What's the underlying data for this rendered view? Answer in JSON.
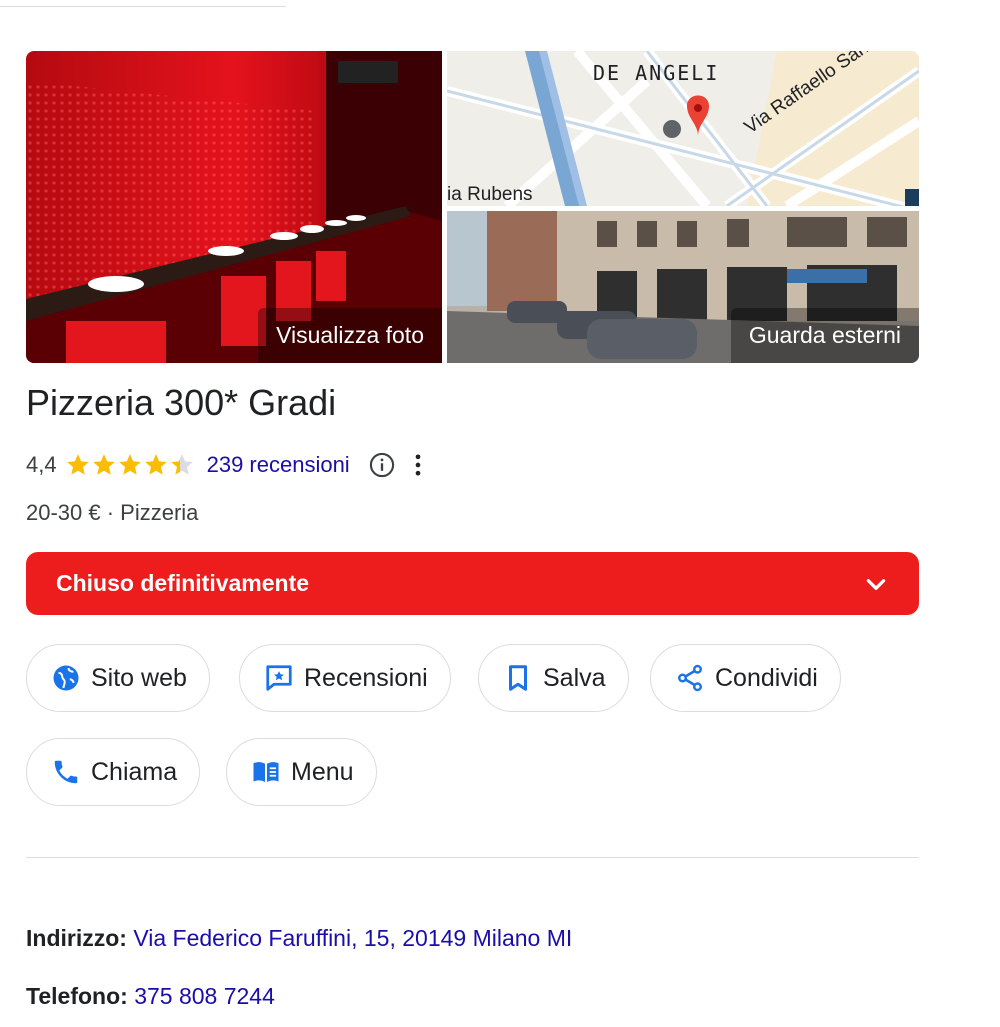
{
  "photos": {
    "main_label": "Visualizza foto",
    "street_label": "Guarda esterni",
    "map_labels": {
      "district": "DE ANGELI",
      "street_left": "ia Rubens",
      "street_right": "Via Raffaello Sanzio"
    }
  },
  "place": {
    "name": "Pizzeria 300* Gradi",
    "rating": "4,4",
    "stars": 4.4,
    "reviews": "239 recensioni",
    "subline": "20-30 € · Pizzeria"
  },
  "status": {
    "label": "Chiuso definitivamente",
    "color": "#ee1d1d"
  },
  "actions": [
    {
      "label": "Sito web",
      "icon": "globe-icon"
    },
    {
      "label": "Recensioni",
      "icon": "review-icon"
    },
    {
      "label": "Salva",
      "icon": "bookmark-icon"
    },
    {
      "label": "Condividi",
      "icon": "share-icon"
    },
    {
      "label": "Chiama",
      "icon": "phone-icon"
    },
    {
      "label": "Menu",
      "icon": "menu-book-icon"
    }
  ],
  "details": {
    "address_label": "Indirizzo:",
    "address_value": "Via Federico Faruffini, 15, 20149 Milano MI",
    "phone_label": "Telefono:",
    "phone_value": "375 808 7244"
  },
  "colors": {
    "accent_blue": "#1a73e8",
    "link": "#1a0dab",
    "star": "#fbbc04"
  }
}
